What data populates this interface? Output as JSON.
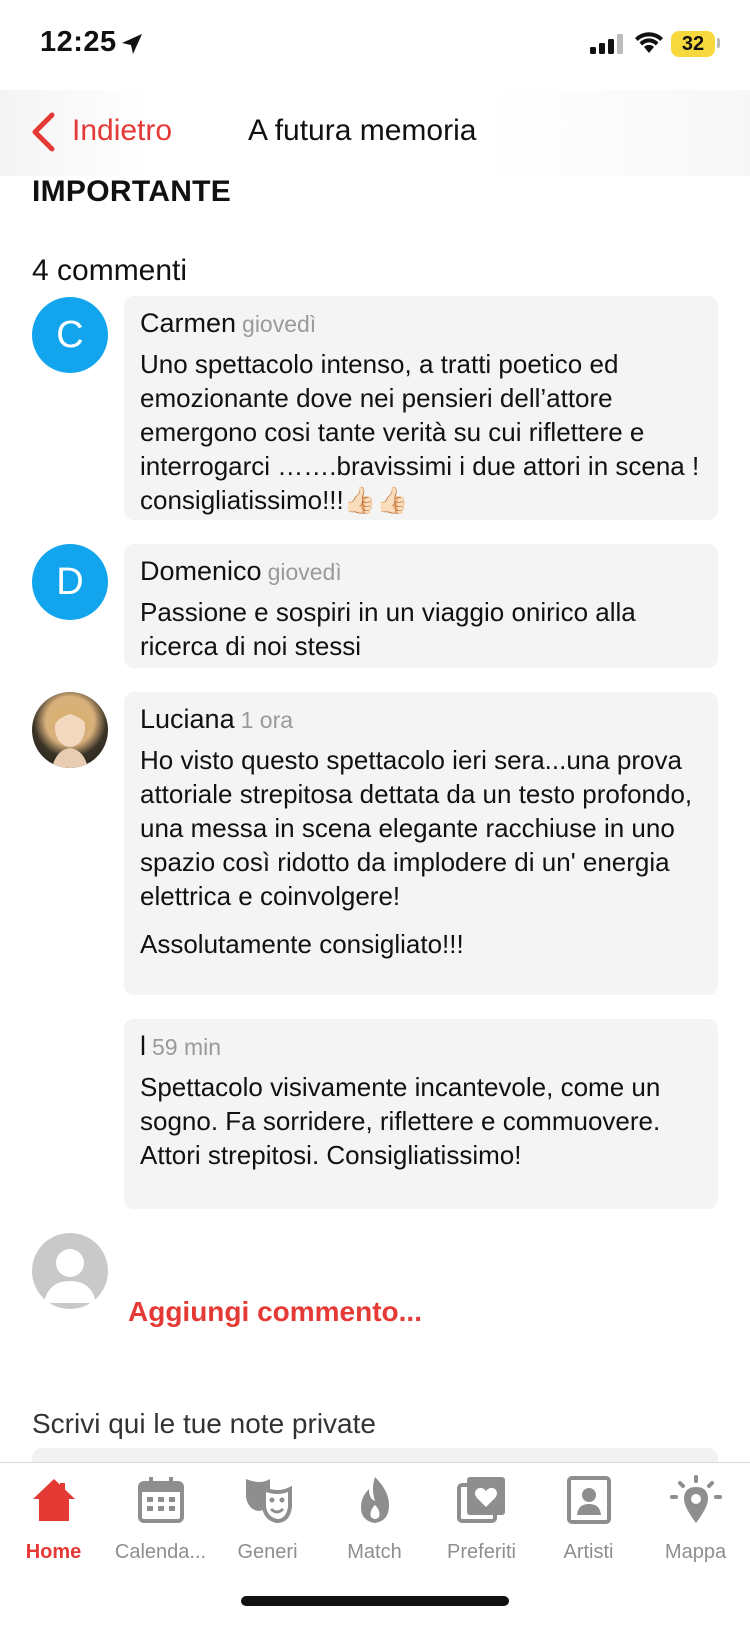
{
  "status": {
    "time": "12:25",
    "battery": "32"
  },
  "nav": {
    "back_label": "Indietro",
    "title": "A futura memoria"
  },
  "section_heading": "IMPORTANTE",
  "comments_count_label": "4 commenti",
  "comments": [
    {
      "author": "Carmen",
      "time": "giovedì",
      "avatar_letter": "C",
      "text": "Uno spettacolo intenso, a tratti poetico ed emozionante dove nei pensieri dell’attore emergono cosi tante verità su cui riflettere e interrogarci …….bravissimi i due attori in scena ! consigliatissimo!!!👍🏻👍🏻"
    },
    {
      "author": "Domenico",
      "time": "giovedì",
      "avatar_letter": "D",
      "text": "Passione e sospiri in un viaggio onirico alla ricerca di noi stessi"
    },
    {
      "author": "Luciana",
      "time": "1 ora",
      "text": "Ho visto questo spettacolo ieri sera...una prova attoriale strepitosa dettata da un testo profondo, una messa in scena elegante racchiuse in uno spazio così ridotto da implodere di un' energia elettrica e coinvolgere!",
      "text2": "Assolutamente consigliato!!!"
    },
    {
      "author": "l",
      "time": "59 min",
      "text": "Spettacolo visivamente incantevole, come un sogno. Fa sorridere, riflettere e commuovere. Attori strepitosi. Consigliatissimo!"
    }
  ],
  "add_comment_label": "Aggiungi commento...",
  "notes_label": "Scrivi qui le tue note private",
  "tabs": [
    {
      "label": "Home",
      "icon": "home-icon",
      "active": true
    },
    {
      "label": "Calenda...",
      "icon": "calendar-icon"
    },
    {
      "label": "Generi",
      "icon": "theater-masks-icon"
    },
    {
      "label": "Match",
      "icon": "flame-icon"
    },
    {
      "label": "Preferiti",
      "icon": "heart-photos-icon"
    },
    {
      "label": "Artisti",
      "icon": "contact-card-icon"
    },
    {
      "label": "Mappa",
      "icon": "map-pin-lightbulb-icon"
    }
  ],
  "colors": {
    "accent": "#e53935",
    "avatar_blue": "#12a5ee",
    "bubble_bg": "#f4f4f4",
    "battery": "#f8d93d"
  }
}
